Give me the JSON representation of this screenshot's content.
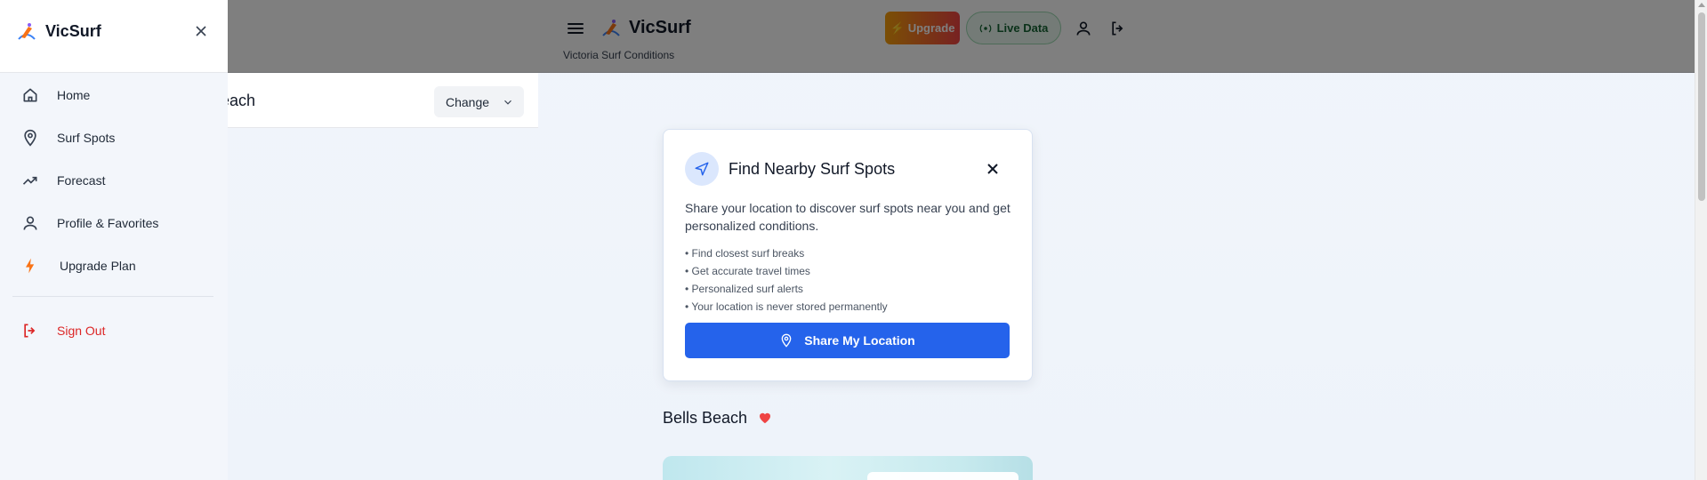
{
  "header": {
    "title": "VicSurf",
    "subtitle": "Victoria Surf Conditions",
    "upgrade_label": "Upgrade",
    "live_label": "Live Data"
  },
  "sidebar": {
    "title": "VicSurf",
    "items": [
      {
        "label": "Home",
        "icon": "home-icon"
      },
      {
        "label": "Surf Spots",
        "icon": "map-pin-icon"
      },
      {
        "label": "Forecast",
        "icon": "trending-up-icon"
      },
      {
        "label": "Profile & Favorites",
        "icon": "user-icon"
      },
      {
        "label": "Upgrade Plan",
        "icon": "lightning-icon"
      }
    ],
    "signout_label": "Sign Out"
  },
  "location": {
    "name": "Bells Beach",
    "change_label": "Change"
  },
  "nearby_card": {
    "title": "Find Nearby Surf Spots",
    "description": "Share your location to discover surf spots near you and get personalized conditions.",
    "bullets": [
      "• Find closest surf breaks",
      "• Get accurate travel times",
      "• Personalized surf alerts",
      "• Your location is never stored permanently"
    ],
    "share_label": "Share My Location"
  },
  "spot": {
    "title": "Bells Beach",
    "favorited": true
  },
  "colors": {
    "primary": "#2563eb",
    "danger": "#dc2626",
    "upgrade_start": "#f59e0b",
    "upgrade_end": "#ef4444",
    "live_green": "#166534"
  }
}
